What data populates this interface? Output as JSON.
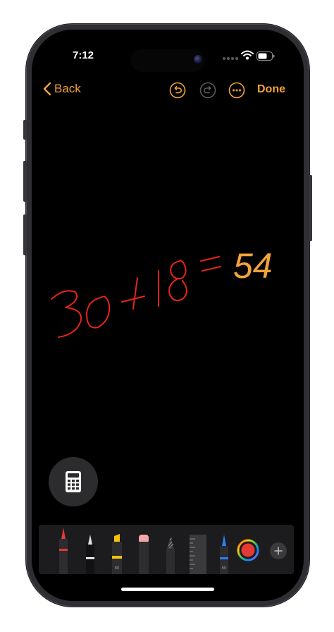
{
  "status_bar": {
    "time": "7:12",
    "wifi_icon": "wifi-icon",
    "battery_icon": "battery-icon"
  },
  "nav": {
    "back_label": "Back",
    "undo_icon": "undo-icon",
    "redo_icon": "redo-icon",
    "more_icon": "more-icon",
    "done_label": "Done",
    "accent_color": "#f2a33a"
  },
  "canvas": {
    "expression_written": "30+18=",
    "expression_color": "#e8241c",
    "result": "54",
    "result_color": "#f2a33a"
  },
  "calculator_button": {
    "icon": "calculator-icon"
  },
  "tools": {
    "items": [
      {
        "name": "pen",
        "color": "#e53935"
      },
      {
        "name": "monoline-pen",
        "color": "#ffffff"
      },
      {
        "name": "highlighter",
        "color": "#f4c20d",
        "label": "80"
      },
      {
        "name": "eraser",
        "color": "#f4a6a6"
      },
      {
        "name": "lasso",
        "color": "#8e8e93"
      },
      {
        "name": "ruler",
        "color": "#6e6e73"
      },
      {
        "name": "pencil",
        "color": "#2f7cf6",
        "label": "50"
      }
    ],
    "selected_color": "#e53935",
    "add_icon": "plus-icon"
  }
}
